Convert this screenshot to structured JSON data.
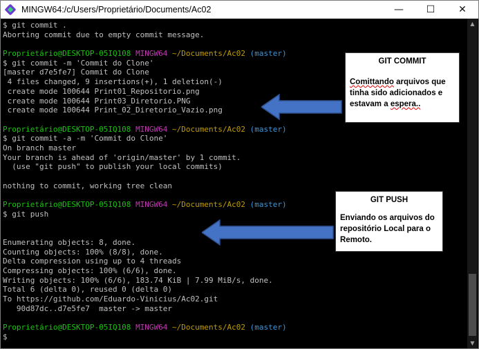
{
  "window": {
    "title": "MINGW64:/c/Users/Proprietário/Documents/Ac02",
    "controls": {
      "minimize": "—",
      "maximize": "☐",
      "close": "✕"
    }
  },
  "terminal": {
    "lines": [
      {
        "type": "text",
        "text": "$ git commit ."
      },
      {
        "type": "text",
        "text": "Aborting commit due to empty commit message."
      },
      {
        "type": "text",
        "text": ""
      },
      {
        "type": "prompt",
        "user": "Proprietário@DESKTOP-05IQ108",
        "host": "MINGW64",
        "path": "~/Documents/Ac02",
        "branch": "(master)"
      },
      {
        "type": "text",
        "text": "$ git commit -m 'Commit do Clone'"
      },
      {
        "type": "text",
        "text": "[master d7e5fe7] Commit do Clone"
      },
      {
        "type": "text",
        "text": " 4 files changed, 9 insertions(+), 1 deletion(-)"
      },
      {
        "type": "text",
        "text": " create mode 100644 Print01_Repositorio.png"
      },
      {
        "type": "text",
        "text": " create mode 100644 Print03_Diretorio.PNG"
      },
      {
        "type": "text",
        "text": " create mode 100644 Print_02_Diretorio_Vazio.png"
      },
      {
        "type": "text",
        "text": ""
      },
      {
        "type": "prompt",
        "user": "Proprietário@DESKTOP-05IQ108",
        "host": "MINGW64",
        "path": "~/Documents/Ac02",
        "branch": "(master)"
      },
      {
        "type": "text",
        "text": "$ git commit -a -m 'Commit do Clone'"
      },
      {
        "type": "text",
        "text": "On branch master"
      },
      {
        "type": "text",
        "text": "Your branch is ahead of 'origin/master' by 1 commit."
      },
      {
        "type": "text",
        "text": "  (use \"git push\" to publish your local commits)"
      },
      {
        "type": "text",
        "text": ""
      },
      {
        "type": "text",
        "text": "nothing to commit, working tree clean"
      },
      {
        "type": "text",
        "text": ""
      },
      {
        "type": "prompt",
        "user": "Proprietário@DESKTOP-05IQ108",
        "host": "MINGW64",
        "path": "~/Documents/Ac02",
        "branch": "(master)"
      },
      {
        "type": "text",
        "text": "$ git push"
      },
      {
        "type": "text",
        "text": ""
      },
      {
        "type": "text",
        "text": ""
      },
      {
        "type": "text",
        "text": "Enumerating objects: 8, done."
      },
      {
        "type": "text",
        "text": "Counting objects: 100% (8/8), done."
      },
      {
        "type": "text",
        "text": "Delta compression using up to 4 threads"
      },
      {
        "type": "text",
        "text": "Compressing objects: 100% (6/6), done."
      },
      {
        "type": "text",
        "text": "Writing objects: 100% (6/6), 183.74 KiB | 7.99 MiB/s, done."
      },
      {
        "type": "text",
        "text": "Total 6 (delta 0), reused 0 (delta 0)"
      },
      {
        "type": "text",
        "text": "To https://github.com/Eduardo-Vinicius/Ac02.git"
      },
      {
        "type": "text",
        "text": "   90d87dc..d7e5fe7  master -> master"
      },
      {
        "type": "text",
        "text": ""
      },
      {
        "type": "prompt",
        "user": "Proprietário@DESKTOP-05IQ108",
        "host": "MINGW64",
        "path": "~/Documents/Ac02",
        "branch": "(master)"
      },
      {
        "type": "text",
        "text": "$"
      }
    ]
  },
  "callouts": {
    "commit": {
      "title": "GIT COMMIT",
      "word1": "Comittando",
      "rest1": " arquivos que",
      "line2": "tinha sido adicionados e",
      "line3_pre": "estavam a ",
      "line3_word": "espera..",
      "arrow_color": "#4472c4"
    },
    "push": {
      "title": "GIT PUSH",
      "line1": "Enviando os arquivos do",
      "line2": "repositório Local para o",
      "line3": "Remoto.",
      "arrow_color": "#4472c4"
    }
  },
  "colors": {
    "prompt_user": "#16c60c",
    "prompt_host": "#c239b3",
    "prompt_path": "#c19c00",
    "prompt_branch": "#3a96dd",
    "terminal_text": "#c0c0c0",
    "terminal_bg": "#000000"
  }
}
